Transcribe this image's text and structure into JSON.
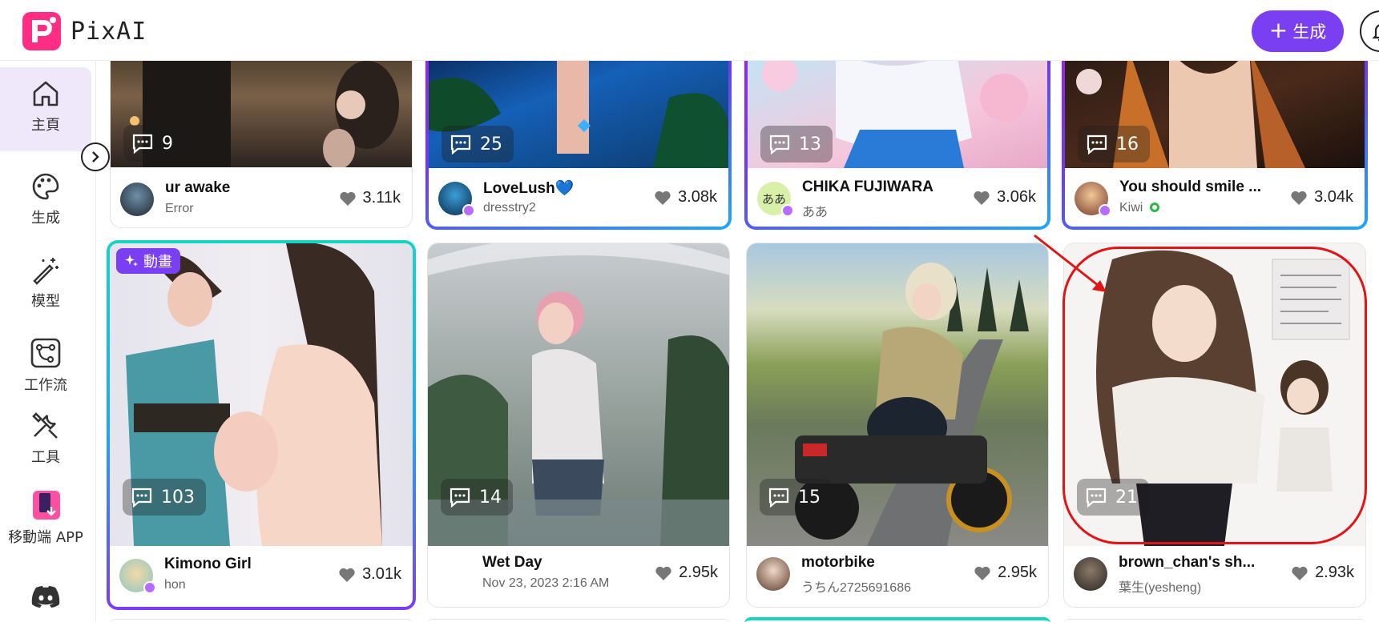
{
  "header": {
    "logo_letter": "P",
    "app_name": "PixAI",
    "generate_button": "生成",
    "generate_plus": "+"
  },
  "sidebar": {
    "items": [
      {
        "label": "主頁",
        "icon": "home-icon"
      },
      {
        "label": "生成",
        "icon": "palette-icon"
      },
      {
        "label": "模型",
        "icon": "magic-wand-icon"
      },
      {
        "label": "工作流",
        "icon": "workflow-icon"
      },
      {
        "label": "工具",
        "icon": "tools-icon"
      },
      {
        "label": "移動端 APP",
        "icon": "mobile-app-icon"
      },
      {
        "label": "",
        "icon": "discord-icon"
      }
    ]
  },
  "cards_top": [
    {
      "comments": "9",
      "title": "ur awake",
      "subtitle": "Error",
      "likes": "3.11k"
    },
    {
      "comments": "25",
      "title": "LoveLush",
      "title_emoji": "💙",
      "subtitle": "dresstry2",
      "likes": "3.08k"
    },
    {
      "comments": "13",
      "title": "CHIKA FUJIWARA",
      "subtitle": "ああ",
      "avatar_text": "ああ",
      "likes": "3.06k"
    },
    {
      "comments": "16",
      "title": "You should smile ...",
      "subtitle": "Kiwi",
      "likes": "3.04k"
    }
  ],
  "cards_bottom": [
    {
      "badge": "動畫",
      "comments": "103",
      "title": "Kimono Girl",
      "subtitle": "hon",
      "likes": "3.01k"
    },
    {
      "comments": "14",
      "title": "Wet Day",
      "subtitle": "Nov 23, 2023 2:16 AM",
      "likes": "2.95k"
    },
    {
      "comments": "15",
      "title": "motorbike",
      "subtitle": "うちん2725691686",
      "likes": "2.95k"
    },
    {
      "comments": "21",
      "title": "brown_chan's sh...",
      "subtitle": "葉生(yesheng)",
      "likes": "2.93k"
    }
  ],
  "colors": {
    "accent": "#7b3ff2",
    "logo": "#ff2e84",
    "highlight": "#e01515"
  }
}
